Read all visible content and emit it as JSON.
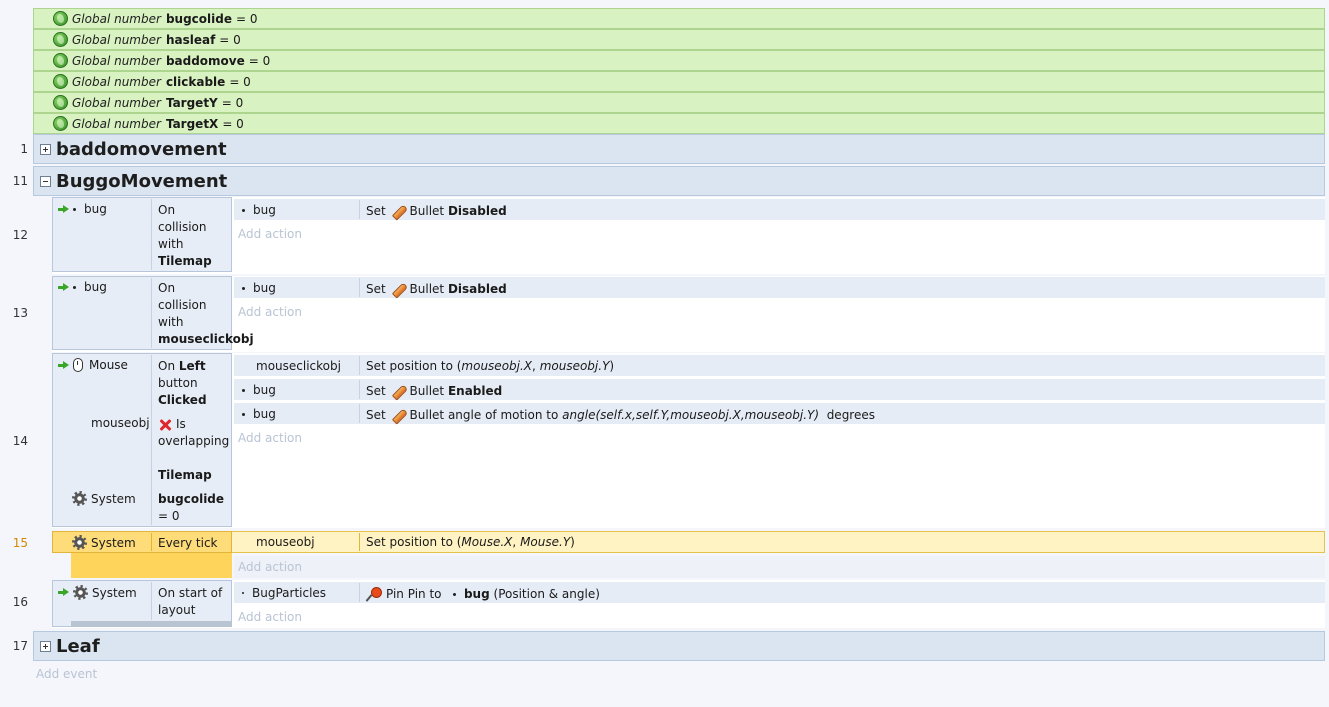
{
  "globals": [
    {
      "type": "Global number",
      "name": "bugcolide",
      "value": "= 0"
    },
    {
      "type": "Global number",
      "name": "hasleaf",
      "value": "= 0"
    },
    {
      "type": "Global number",
      "name": "baddomove",
      "value": "= 0"
    },
    {
      "type": "Global number",
      "name": "clickable",
      "value": "= 0"
    },
    {
      "type": "Global number",
      "name": "TargetY",
      "value": "= 0"
    },
    {
      "type": "Global number",
      "name": "TargetX",
      "value": "= 0"
    }
  ],
  "groups": {
    "baddo": {
      "line": "1",
      "title": "baddomovement"
    },
    "buggo": {
      "line": "11",
      "title": "BuggoMovement"
    },
    "leaf": {
      "line": "17",
      "title": "Leaf"
    }
  },
  "events": {
    "e12": {
      "line": "12",
      "cond_obj": "bug",
      "cond_l1": "On",
      "cond_l2": "collision",
      "cond_l3": "with",
      "cond_l4": "Tilemap",
      "act_obj": "bug",
      "act_set": "Set",
      "act_beh": "Bullet",
      "act_val": "Disabled",
      "add_action": "Add action"
    },
    "e13": {
      "line": "13",
      "cond_obj": "bug",
      "cond_l1": "On",
      "cond_l2": "collision",
      "cond_l3": "with",
      "cond_l4": "mouseclickobj",
      "act_obj": "bug",
      "act_set": "Set",
      "act_beh": "Bullet",
      "act_val": "Disabled",
      "add_action": "Add action"
    },
    "e14": {
      "line": "14",
      "c1_obj": "Mouse",
      "c1_l1a": "On",
      "c1_l1b": "Left",
      "c1_l2": "button",
      "c1_l3": "Clicked",
      "c2_obj": "mouseobj",
      "c2_l1": "Is",
      "c2_l2": "overlapping",
      "c2_l3": "Tilemap",
      "c3_obj": "System",
      "c3_l1": "bugcolide",
      "c3_l2": "= 0",
      "a1_obj": "mouseclickobj",
      "a1_text": "Set position to (",
      "a1_x": "mouseobj.X",
      "a1_comma": ",",
      "a1_y": "mouseobj.Y",
      "a1_close": ")",
      "a2_obj": "bug",
      "a2_set": "Set",
      "a2_beh": "Bullet",
      "a2_val": "Enabled",
      "a3_obj": "bug",
      "a3_set": "Set",
      "a3_beh": "Bullet angle of motion to",
      "a3_expr": "angle(self.x,self.Y,mouseobj.X,mouseobj.Y)",
      "a3_unit": "degrees",
      "add_action": "Add action"
    },
    "e15": {
      "line": "15",
      "cond_obj": "System",
      "cond_text": "Every tick",
      "act_obj": "mouseobj",
      "act_text": "Set position to (",
      "act_x": "Mouse.X",
      "act_comma": ",",
      "act_y": "Mouse.Y",
      "act_close": ")",
      "add_action": "Add action"
    },
    "e16": {
      "line": "16",
      "cond_obj": "System",
      "cond_l1": "On start of",
      "cond_l2": "layout",
      "act_obj": "BugParticles",
      "act_pin": "Pin Pin to",
      "act_target": "bug",
      "act_mode": "(Position & angle)",
      "add_action": "Add action"
    }
  },
  "add_event": "Add event",
  "colors": {
    "global_bg": "#d9f2c2",
    "group_bg": "#dbe5f1",
    "selected_row": "#fff2c3",
    "selected_cond": "#ffd45a",
    "line_selected": "#e0a000"
  }
}
